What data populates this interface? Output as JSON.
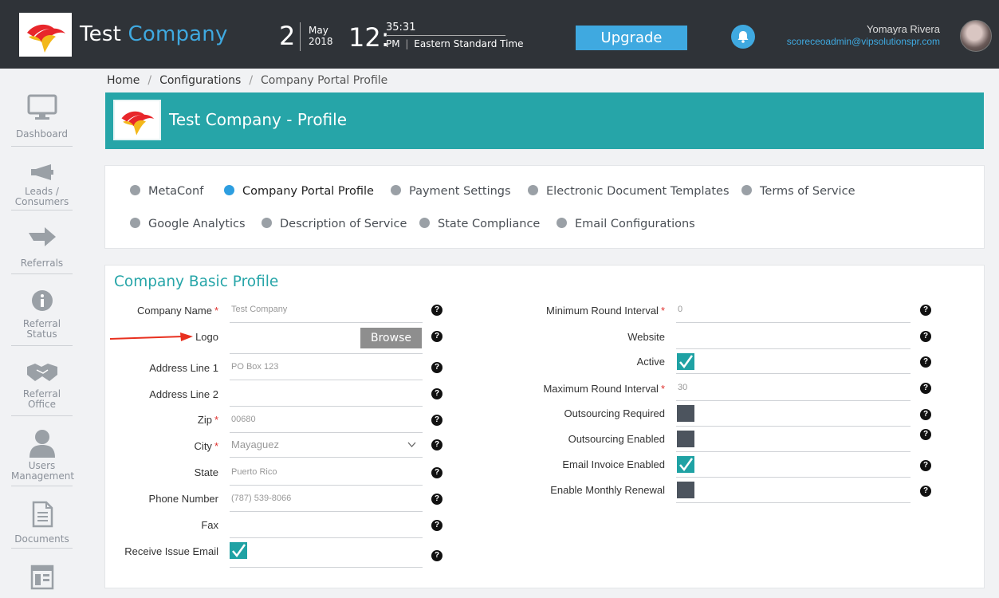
{
  "header": {
    "brand_first": "Test",
    "brand_second": "Company",
    "date_day": "2",
    "date_month": "May",
    "date_year": "2018",
    "time_hour": "12:",
    "time_seconds": "35:31",
    "time_ampm": "PM",
    "time_zone": "Eastern Standard Time",
    "upgrade_label": "Upgrade",
    "user_name": "Yomayra Rivera",
    "user_email": "scoreceoadmin@vipsolutionspr.com"
  },
  "sidebar": {
    "items": [
      {
        "label": "Dashboard",
        "icon": "monitor-icon"
      },
      {
        "label": "Leads / Consumers",
        "icon": "megaphone-icon"
      },
      {
        "label": "Referrals",
        "icon": "arrow-right-icon"
      },
      {
        "label": "Referral Status",
        "icon": "info-icon"
      },
      {
        "label": "Referral Office",
        "icon": "handshake-icon"
      },
      {
        "label": "Users Management",
        "icon": "user-icon"
      },
      {
        "label": "Documents",
        "icon": "document-icon"
      }
    ]
  },
  "breadcrumb": {
    "home": "Home",
    "configurations": "Configurations",
    "current": "Company Portal Profile",
    "separator": "/"
  },
  "banner": {
    "title": "Test Company - Profile"
  },
  "tabs": [
    {
      "label": "MetaConf",
      "active": false
    },
    {
      "label": "Company Portal Profile",
      "active": true
    },
    {
      "label": "Payment Settings",
      "active": false
    },
    {
      "label": "Electronic Document Templates",
      "active": false
    },
    {
      "label": "Terms of Service",
      "active": false
    },
    {
      "label": "Google Analytics",
      "active": false
    },
    {
      "label": "Description of Service",
      "active": false
    },
    {
      "label": "State Compliance",
      "active": false
    },
    {
      "label": "Email Configurations",
      "active": false
    }
  ],
  "form": {
    "section_title": "Company Basic Profile",
    "required_mark": "*",
    "help_glyph": "?",
    "browse_label": "Browse",
    "left": {
      "company_name_label": "Company Name",
      "company_name_placeholder": "Test Company",
      "logo_label": "Logo",
      "address1_label": "Address Line 1",
      "address1_placeholder": "PO Box 123",
      "address2_label": "Address Line 2",
      "zip_label": "Zip",
      "zip_placeholder": "00680",
      "city_label": "City",
      "city_value": "Mayaguez",
      "state_label": "State",
      "state_placeholder": "Puerto Rico",
      "phone_label": "Phone Number",
      "phone_placeholder": "(787) 539-8066",
      "fax_label": "Fax",
      "receive_issue_email_label": "Receive Issue Email",
      "receive_issue_email_checked": true
    },
    "right": {
      "min_round_label": "Minimum Round Interval",
      "min_round_placeholder": "0",
      "website_label": "Website",
      "active_label": "Active",
      "active_checked": true,
      "max_round_label": "Maximum Round Interval",
      "max_round_placeholder": "30",
      "outsourcing_required_label": "Outsourcing Required",
      "outsourcing_required_checked": false,
      "outsourcing_enabled_label": "Outsourcing Enabled",
      "outsourcing_enabled_checked": false,
      "email_invoice_label": "Email Invoice Enabled",
      "email_invoice_checked": true,
      "monthly_renewal_label": "Enable Monthly Renewal",
      "monthly_renewal_checked": false
    }
  },
  "colors": {
    "header_bg": "#2f3338",
    "accent_blue": "#3fa9e0",
    "teal": "#26a5a8",
    "required": "#e0312e",
    "annotation_arrow": "#e8301f"
  }
}
